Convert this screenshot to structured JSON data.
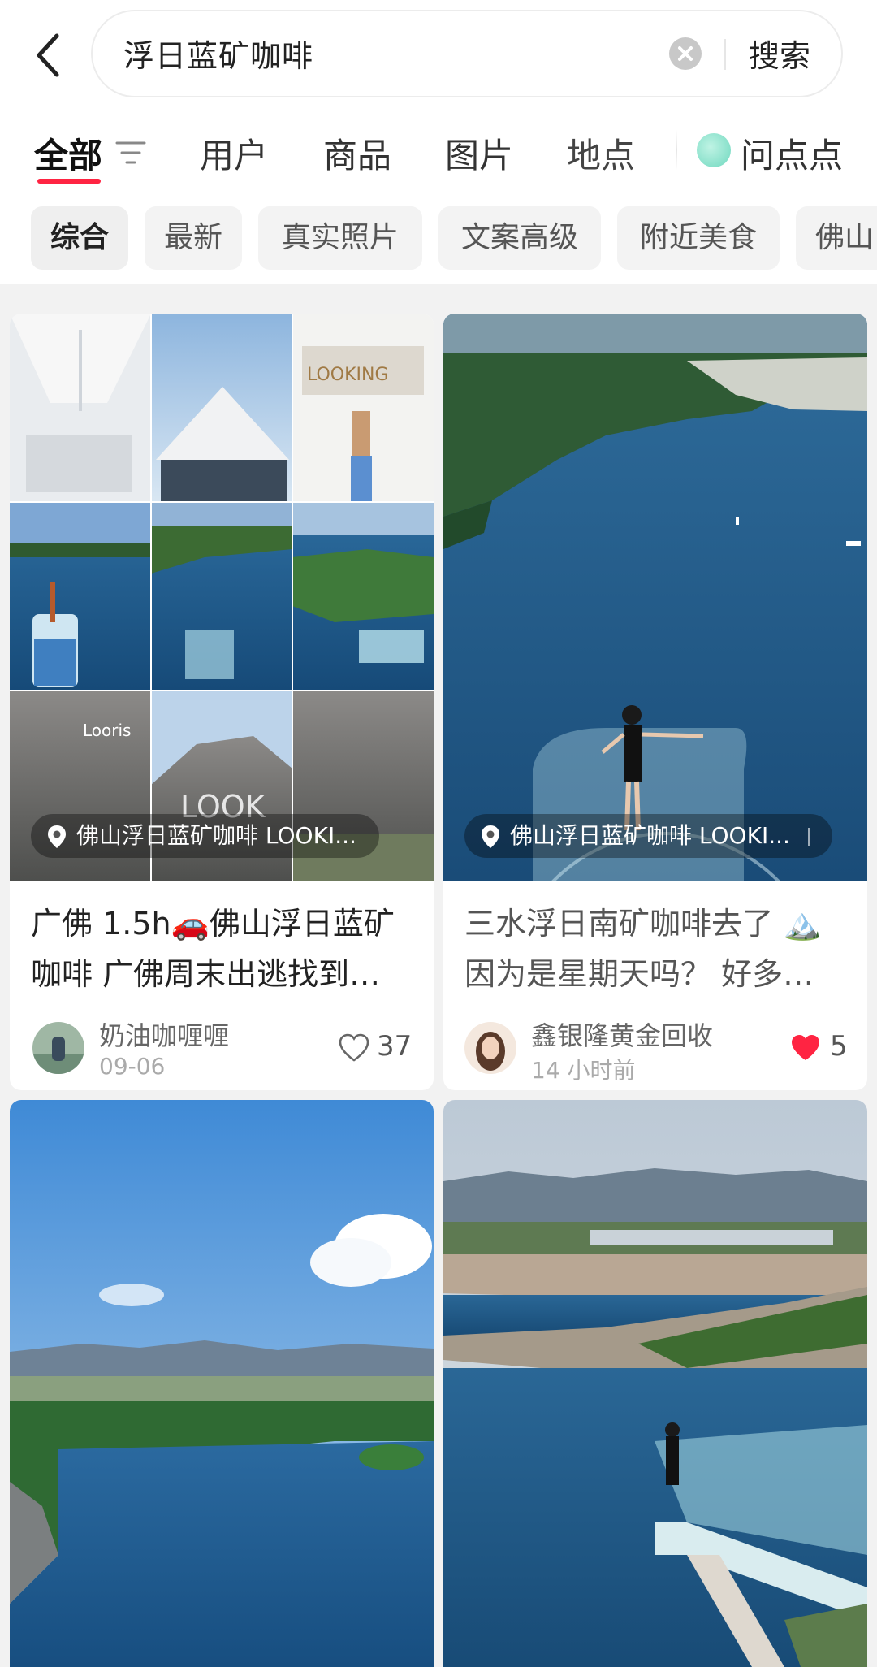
{
  "search": {
    "query": "浮日蓝矿咖啡",
    "submit_label": "搜索"
  },
  "tabs": [
    {
      "label": "全部",
      "active": true
    },
    {
      "label": "用户"
    },
    {
      "label": "商品"
    },
    {
      "label": "图片"
    },
    {
      "label": "地点"
    },
    {
      "label": "问点点"
    }
  ],
  "filters": [
    "综合",
    "最新",
    "真实照片",
    "文案高级",
    "附近美食",
    "佛山"
  ],
  "feed": [
    {
      "location": "佛山浮日蓝矿咖啡 LOOKI...",
      "title": "广佛 1.5h🚗佛山浮日蓝矿咖啡 广佛周末出逃找到…",
      "author": "奶油咖喱喱",
      "time": "09-06",
      "likes": "37",
      "liked": false
    },
    {
      "location": "佛山浮日蓝矿咖啡 LOOKI...",
      "title": "三水浮日南矿咖啡去了 🏔️ 因为是星期天吗？ 好多…",
      "author": "鑫银隆黄金回收",
      "time": "14 小时前",
      "likes": "5",
      "liked": true
    }
  ],
  "colors": {
    "accent": "#ff2442",
    "lake": "#1f5f8f",
    "sky": "#6fa6db"
  }
}
